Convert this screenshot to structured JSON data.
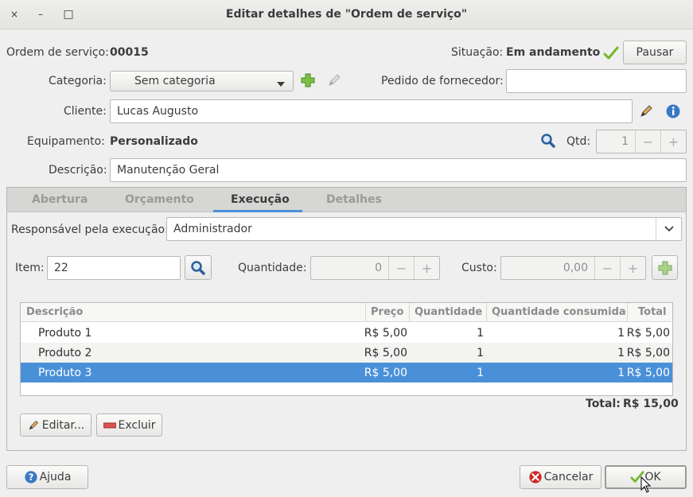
{
  "window": {
    "title": "Editar detalhes de \"Ordem de serviço\"",
    "close_glyph": "×",
    "minimize_glyph": "–",
    "maximize_glyph": "□"
  },
  "header": {
    "order_label": "Ordem de serviço:",
    "order_value": "00015",
    "status_label": "Situação:",
    "status_value": "Em andamento",
    "pause_button": "Pausar"
  },
  "form": {
    "category_label": "Categoria:",
    "category_value": "Sem categoria",
    "supplier_order_label": "Pedido de fornecedor:",
    "supplier_order_value": "",
    "client_label": "Cliente:",
    "client_value": "Lucas Augusto",
    "equipment_label": "Equipamento:",
    "equipment_value": "Personalizado",
    "qty_label": "Qtd:",
    "qty_value": "1",
    "description_label": "Descrição:",
    "description_value": "Manutenção Geral"
  },
  "tabs": [
    {
      "label": "Abertura"
    },
    {
      "label": "Orçamento"
    },
    {
      "label": "Execução"
    },
    {
      "label": "Detalhes"
    }
  ],
  "execution": {
    "responsible_label": "Responsável pela execução:",
    "responsible_value": "Administrador",
    "item_label": "Item:",
    "item_value": "22",
    "quantity_label": "Quantidade:",
    "quantity_value": "0",
    "cost_label": "Custo:",
    "cost_value": "0,00",
    "spin_minus": "−",
    "spin_plus": "+"
  },
  "table": {
    "columns": [
      "Descrição",
      "Preço",
      "Quantidade",
      "Quantidade consumida",
      "Total"
    ],
    "rows": [
      {
        "descricao": "Produto 1",
        "preco": "R$ 5,00",
        "quantidade": "1",
        "consumida": "1",
        "total": "R$ 5,00"
      },
      {
        "descricao": "Produto 2",
        "preco": "R$ 5,00",
        "quantidade": "1",
        "consumida": "1",
        "total": "R$ 5,00"
      },
      {
        "descricao": "Produto 3",
        "preco": "R$ 5,00",
        "quantidade": "1",
        "consumida": "1",
        "total": "R$ 5,00"
      }
    ],
    "selected_row": 2,
    "total_label": "Total:",
    "total_value": "R$ 15,00"
  },
  "actions": {
    "edit_button": "Editar...",
    "delete_button": "Excluir",
    "help_button": "Ajuda",
    "cancel_button": "Cancelar",
    "ok_button": "OK"
  },
  "colors": {
    "accent": "#4a90d9",
    "status_ok": "#73b72b",
    "add_green": "#73b72b",
    "cancel_red": "#cc2a2a",
    "info_blue": "#3b78c4"
  }
}
